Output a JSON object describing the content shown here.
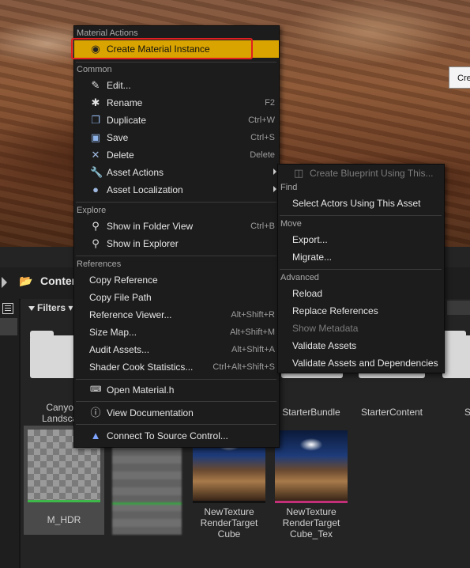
{
  "viewport": {
    "button_label": "Cre"
  },
  "content_browser": {
    "path": "Conten",
    "filters_label": "Filters",
    "folders": [
      {
        "label": "Canyon\nLandscap"
      },
      {
        "label": "StarterBundle"
      },
      {
        "label": "StarterContent"
      },
      {
        "label": "S"
      }
    ],
    "assets": [
      {
        "label": "M_HDR",
        "bar_color": "#3fb84a"
      },
      {
        "label": "",
        "bar_color": "#3fb84a"
      },
      {
        "label": "NewTexture\nRenderTarget\nCube",
        "bar_color": "#111111"
      },
      {
        "label": "NewTexture\nRenderTarget\nCube_Tex",
        "bar_color": "#c2307a"
      }
    ]
  },
  "menu": {
    "sections": {
      "material_actions": "Material Actions",
      "common": "Common",
      "explore": "Explore",
      "references": "References"
    },
    "create_material_instance": "Create Material Instance",
    "edit": "Edit...",
    "rename": "Rename",
    "rename_sc": "F2",
    "duplicate": "Duplicate",
    "duplicate_sc": "Ctrl+W",
    "save": "Save",
    "save_sc": "Ctrl+S",
    "delete": "Delete",
    "delete_sc": "Delete",
    "asset_actions": "Asset Actions",
    "asset_localization": "Asset Localization",
    "show_folder_view": "Show in Folder View",
    "show_folder_view_sc": "Ctrl+B",
    "show_explorer": "Show in Explorer",
    "copy_reference": "Copy Reference",
    "copy_file_path": "Copy File Path",
    "reference_viewer": "Reference Viewer...",
    "reference_viewer_sc": "Alt+Shift+R",
    "size_map": "Size Map...",
    "size_map_sc": "Alt+Shift+M",
    "audit_assets": "Audit Assets...",
    "audit_assets_sc": "Alt+Shift+A",
    "shader_cook": "Shader Cook Statistics...",
    "shader_cook_sc": "Ctrl+Alt+Shift+S",
    "open_material_h": "Open Material.h",
    "view_documentation": "View Documentation",
    "connect_source_control": "Connect To Source Control..."
  },
  "submenu": {
    "create_blueprint": "Create Blueprint Using This...",
    "find": "Find",
    "select_actors": "Select Actors Using This Asset",
    "move": "Move",
    "export": "Export...",
    "migrate": "Migrate...",
    "advanced": "Advanced",
    "reload": "Reload",
    "replace_references": "Replace References",
    "show_metadata": "Show Metadata",
    "validate_assets": "Validate Assets",
    "validate_assets_deps": "Validate Assets and Dependencies"
  },
  "colors": {
    "highlight": "#d9a400",
    "annotation_box": "#e02020"
  }
}
